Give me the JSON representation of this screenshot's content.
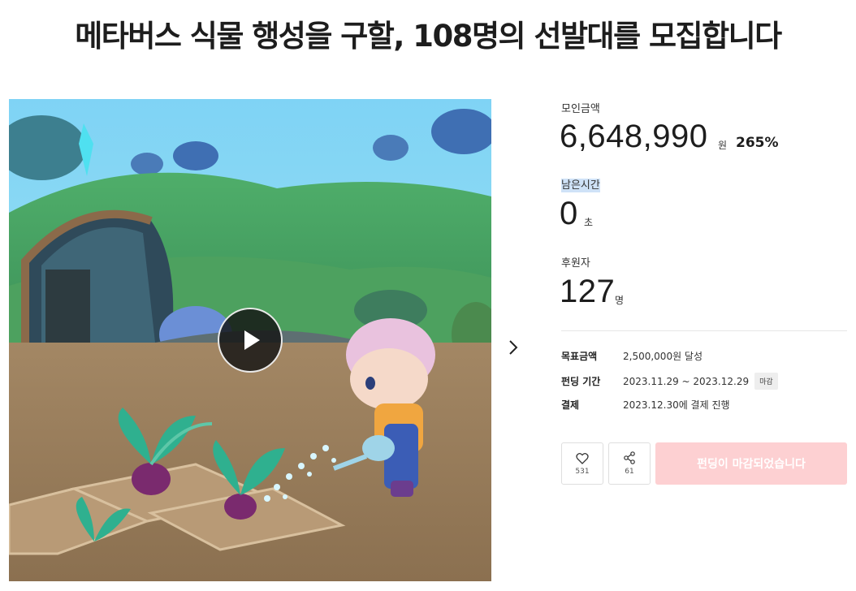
{
  "title": "메타버스 식물 행성을 구할, 108명의 선발대를 모집합니다",
  "funding": {
    "amount_label": "모인금액",
    "amount_value": "6,648,990",
    "amount_unit": "원",
    "percent": "265%",
    "time_label": "남은시간",
    "time_value": "0",
    "time_unit": "초",
    "backers_label": "후원자",
    "backers_value": "127",
    "backers_unit": "명"
  },
  "details": {
    "goal_key": "목표금액",
    "goal_value": "2,500,000원 달성",
    "period_key": "펀딩 기간",
    "period_value": "2023.11.29 ~ 2023.12.29",
    "period_badge": "마감",
    "payment_key": "결제",
    "payment_value": "2023.12.30에 결제 진행"
  },
  "actions": {
    "like_count": "531",
    "share_count": "61",
    "closed_label": "펀딩이 마감되었습니다"
  },
  "icons": {
    "play": "play-icon",
    "next": "chevron-right-icon",
    "like": "heart-icon",
    "share": "share-icon"
  },
  "colors": {
    "closed_button": "#fdd0d2",
    "highlight": "#cfe2f7"
  }
}
